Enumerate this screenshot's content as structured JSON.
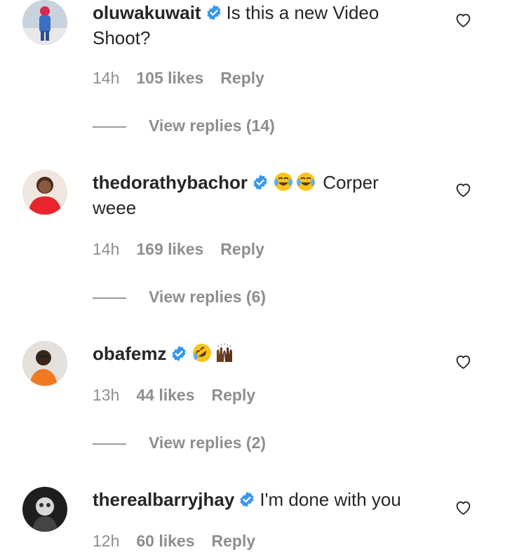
{
  "comments": [
    {
      "username": "oluwakuwait",
      "text": "Is this a new Video Shoot?",
      "time": "14h",
      "likes": "105 likes",
      "reply": "Reply",
      "view_replies": "View replies (14)"
    },
    {
      "username": "thedorathybachor",
      "emojis": [
        "face-with-tears-of-joy",
        "face-with-tears-of-joy"
      ],
      "text": "Corper weee",
      "time": "14h",
      "likes": "169 likes",
      "reply": "Reply",
      "view_replies": "View replies (6)"
    },
    {
      "username": "obafemz",
      "emojis": [
        "rolling-on-the-floor-laughing",
        "raising-hands-dark-skin"
      ],
      "text": "",
      "time": "13h",
      "likes": "44 likes",
      "reply": "Reply",
      "view_replies": "View replies (2)"
    },
    {
      "username": "therealbarryjhay",
      "text": "I'm done with you",
      "time": "12h",
      "likes": "60 likes",
      "reply": "Reply"
    }
  ],
  "colors": {
    "text": "#262626",
    "meta": "#8e8e8e",
    "verified": "#3897f0"
  }
}
